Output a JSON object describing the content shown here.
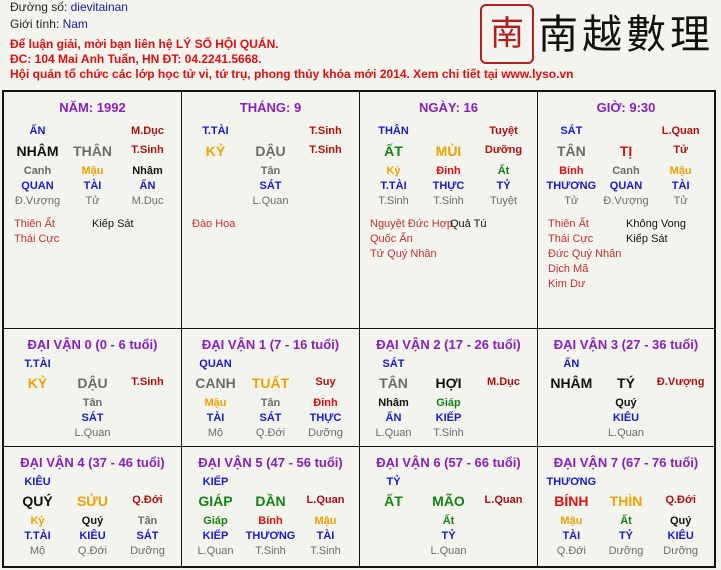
{
  "header": {
    "line1": {
      "label": "Đường số:",
      "value": "dievitainan"
    },
    "line2": {
      "label": "Giới tính:",
      "value": "Nam"
    },
    "line3": "Để luận giải, mời bạn liên hệ LÝ SỐ HỘI QUÁN.",
    "line4": "ĐC: 104 Mai Anh Tuấn, HN ĐT: 04.2241.5668.",
    "line5": "Hội quán tổ chức các lớp học tử vi, tứ trụ, phong thủy khóa mới 2014. Xem chi tiết tại www.lyso.vn"
  },
  "logo": {
    "seal": "南",
    "title": "南越數理"
  },
  "pillars": [
    {
      "title": "NĂM: 1992",
      "top": [
        "ẤN",
        "",
        "M.Dục"
      ],
      "main": [
        "NHÂM",
        "THÂN",
        "T.Sinh"
      ],
      "hidden": [
        "Canh",
        "Mậu",
        "Nhâm"
      ],
      "gods": [
        "QUAN",
        "TÀI",
        "ẤN"
      ],
      "status": [
        "Đ.Vượng",
        "Tử",
        "M.Dục"
      ],
      "stars": [
        [
          "Thiên Ất",
          "Kiếp Sát"
        ],
        [
          "Thái Cực",
          ""
        ]
      ]
    },
    {
      "title": "THÁNG: 9",
      "top": [
        "T.TÀI",
        "",
        "T.Sinh"
      ],
      "main": [
        "KỶ",
        "DẬU",
        "T.Sinh"
      ],
      "hidden": [
        "",
        "Tân",
        ""
      ],
      "gods": [
        "",
        "SÁT",
        ""
      ],
      "status": [
        "",
        "L.Quan",
        ""
      ],
      "stars": [
        [
          "Đào Hoa",
          ""
        ]
      ]
    },
    {
      "title": "NGÀY: 16",
      "top": [
        "THÂN",
        "",
        "Tuyệt"
      ],
      "main": [
        "ẤT",
        "MÙI",
        "Dưỡng"
      ],
      "hidden": [
        "Kỷ",
        "Đinh",
        "Ất"
      ],
      "gods": [
        "T.TÀI",
        "THỰC",
        "TỶ"
      ],
      "status": [
        "T.Sinh",
        "T.Sinh",
        "Tuyệt"
      ],
      "stars": [
        [
          "Nguyệt Đức Hợp",
          "Quả Tú"
        ],
        [
          "Quốc Ấn",
          ""
        ],
        [
          "Tứ Quý Nhân",
          ""
        ]
      ]
    },
    {
      "title": "GIỜ: 9:30",
      "top": [
        "SÁT",
        "",
        "L.Quan"
      ],
      "main": [
        "TÂN",
        "TỊ",
        "Tử"
      ],
      "hidden": [
        "Bính",
        "Canh",
        "Mậu"
      ],
      "gods": [
        "THƯƠNG",
        "QUAN",
        "TÀI"
      ],
      "status": [
        "Tử",
        "Đ.Vượng",
        "Tử"
      ],
      "stars": [
        [
          "Thiên Ất",
          "Không Vong"
        ],
        [
          "Thái Cực",
          "Kiếp Sát"
        ],
        [
          "Đức Quý Nhân",
          ""
        ],
        [
          "Dịch Mã",
          ""
        ],
        [
          "Kim Dư",
          ""
        ]
      ]
    }
  ],
  "luck": [
    {
      "title": "ĐẠI VẬN 0 (0 - 6 tuổi)",
      "top": "T.TÀI",
      "main": [
        "KỶ",
        "DẬU",
        "T.Sinh"
      ],
      "hidden": [
        "",
        "Tân",
        ""
      ],
      "gods": [
        "",
        "SÁT",
        ""
      ],
      "status": [
        "",
        "L.Quan",
        ""
      ]
    },
    {
      "title": "ĐẠI VẬN 1 (7 - 16 tuổi)",
      "top": "QUAN",
      "main": [
        "CANH",
        "TUẤT",
        "Suy"
      ],
      "hidden": [
        "Mậu",
        "Tân",
        "Đinh"
      ],
      "gods": [
        "TÀI",
        "SÁT",
        "THỰC"
      ],
      "status": [
        "Mộ",
        "Q.Đới",
        "Dưỡng"
      ]
    },
    {
      "title": "ĐẠI VẬN 2 (17 - 26 tuổi)",
      "top": "SÁT",
      "main": [
        "TÂN",
        "HỢI",
        "M.Dục"
      ],
      "hidden": [
        "Nhâm",
        "Giáp",
        ""
      ],
      "gods": [
        "ẤN",
        "KIẾP",
        ""
      ],
      "status": [
        "L.Quan",
        "T.Sinh",
        ""
      ]
    },
    {
      "title": "ĐẠI VẬN 3 (27 - 36 tuổi)",
      "top": "ẤN",
      "main": [
        "NHÂM",
        "TÝ",
        "Đ.Vượng"
      ],
      "hidden": [
        "",
        "Quý",
        ""
      ],
      "gods": [
        "",
        "KIÊU",
        ""
      ],
      "status": [
        "",
        "L.Quan",
        ""
      ]
    },
    {
      "title": "ĐẠI VẬN 4 (37 - 46 tuổi)",
      "top": "KIÊU",
      "main": [
        "QUÝ",
        "SỬU",
        "Q.Đới"
      ],
      "hidden": [
        "Kỷ",
        "Quý",
        "Tân"
      ],
      "gods": [
        "T.TÀI",
        "KIÊU",
        "SÁT"
      ],
      "status": [
        "Mộ",
        "Q.Đới",
        "Dưỡng"
      ]
    },
    {
      "title": "ĐẠI VẬN 5 (47 - 56 tuổi)",
      "top": "KIẾP",
      "main": [
        "GIÁP",
        "DẦN",
        "L.Quan"
      ],
      "hidden": [
        "Giáp",
        "Bính",
        "Mậu"
      ],
      "gods": [
        "KIẾP",
        "THƯƠNG",
        "TÀI"
      ],
      "status": [
        "L.Quan",
        "T.Sinh",
        "T.Sinh"
      ]
    },
    {
      "title": "ĐẠI VẬN 6 (57 - 66 tuổi)",
      "top": "TỶ",
      "main": [
        "ẤT",
        "MÃO",
        "L.Quan"
      ],
      "hidden": [
        "",
        "Ất",
        ""
      ],
      "gods": [
        "",
        "TỶ",
        ""
      ],
      "status": [
        "",
        "L.Quan",
        ""
      ]
    },
    {
      "title": "ĐẠI VẬN 7 (67 - 76 tuổi)",
      "top": "THƯƠNG",
      "main": [
        "BÍNH",
        "THÌN",
        "Q.Đới"
      ],
      "hidden": [
        "Mậu",
        "Ất",
        "Quý"
      ],
      "gods": [
        "TÀI",
        "TỶ",
        "KIÊU"
      ],
      "status": [
        "Q.Đới",
        "Dưỡng",
        "Dưỡng"
      ]
    }
  ]
}
